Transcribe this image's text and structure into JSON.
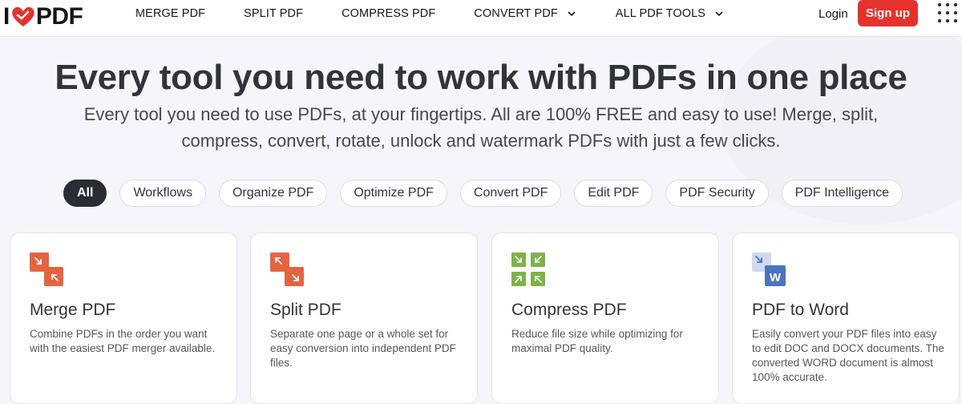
{
  "brand": {
    "logo_left": "I",
    "logo_right": "PDF",
    "accent": "#e5322d"
  },
  "nav": {
    "items": [
      {
        "label": "MERGE PDF"
      },
      {
        "label": "SPLIT PDF"
      },
      {
        "label": "COMPRESS PDF"
      },
      {
        "label": "CONVERT PDF",
        "dropdown": true
      },
      {
        "label": "ALL PDF TOOLS",
        "dropdown": true
      }
    ],
    "login": "Login",
    "signup": "Sign up"
  },
  "hero": {
    "title": "Every tool you need to work with PDFs in one place",
    "subtitle": "Every tool you need to use PDFs, at your fingertips. All are 100% FREE and easy to use! Merge, split, compress, convert, rotate, unlock and watermark PDFs with just a few clicks."
  },
  "filters": [
    "All",
    "Workflows",
    "Organize PDF",
    "Optimize PDF",
    "Convert PDF",
    "Edit PDF",
    "PDF Security",
    "PDF Intelligence"
  ],
  "filter_active": "All",
  "cards": [
    {
      "title": "Merge PDF",
      "desc": "Combine PDFs in the order you want with the easiest PDF merger available.",
      "icon": "merge-icon",
      "color": "#e5643f"
    },
    {
      "title": "Split PDF",
      "desc": "Separate one page or a whole set for easy conversion into independent PDF files.",
      "icon": "split-icon",
      "color": "#e5643f"
    },
    {
      "title": "Compress PDF",
      "desc": "Reduce file size while optimizing for maximal PDF quality.",
      "icon": "compress-icon",
      "color": "#7fb24a"
    },
    {
      "title": "PDF to Word",
      "desc": "Easily convert your PDF files into easy to edit DOC and DOCX documents. The converted WORD document is almost 100% accurate.",
      "icon": "word-icon",
      "color": "#4a74c0",
      "badge": "W"
    }
  ]
}
